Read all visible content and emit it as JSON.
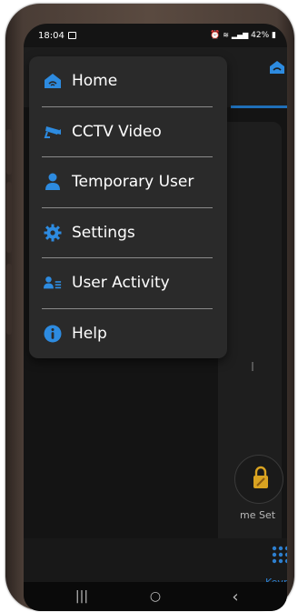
{
  "status_bar": {
    "time": "18:04",
    "battery": "42%",
    "notification_icon": "image-notification-icon",
    "indicators": [
      "alarm-icon",
      "wifi-icon",
      "signal-icon",
      "battery-icon"
    ]
  },
  "drawer": {
    "items": [
      {
        "label": "Home",
        "icon": "home-icon"
      },
      {
        "label": "CCTV Video",
        "icon": "cctv-camera-icon"
      },
      {
        "label": "Temporary User",
        "icon": "user-icon"
      },
      {
        "label": "Settings",
        "icon": "gear-icon"
      },
      {
        "label": "User Activity",
        "icon": "user-list-icon"
      },
      {
        "label": "Help",
        "icon": "info-icon"
      }
    ]
  },
  "background_app": {
    "time_set_label": "me Set",
    "keypad_label": "Keypad"
  },
  "navigation_bar": {
    "recents_glyph": "|||",
    "home_glyph": "○",
    "back_glyph": "‹"
  },
  "colors": {
    "accent": "#2d8be0",
    "drawer_bg": "#2a2a2a",
    "screen_bg": "#141414",
    "lock_gold": "#d9a321"
  }
}
